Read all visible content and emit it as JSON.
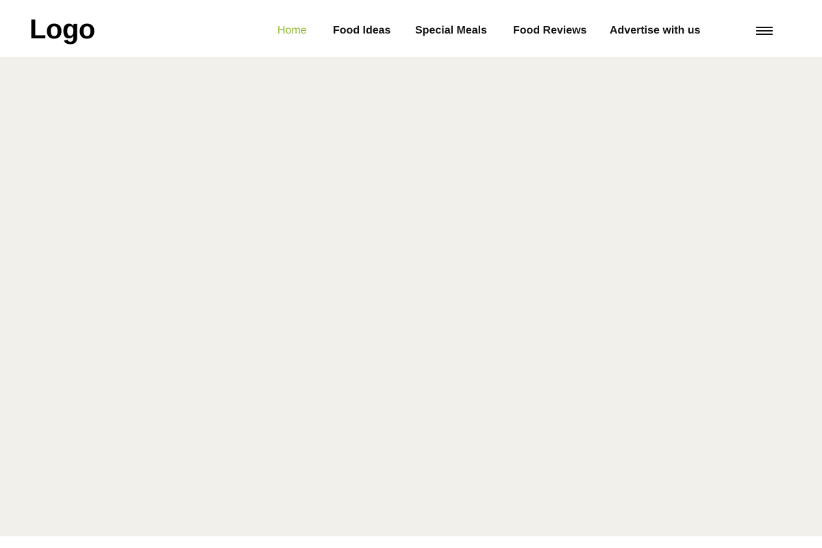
{
  "colors": {
    "accent": "#8bb72a",
    "hero_background": "#f2f0eb",
    "header_background": "#ffffff",
    "text": "#111111"
  },
  "header": {
    "logo_text": "Logo",
    "nav": [
      {
        "label": "Home",
        "active": true
      },
      {
        "label": "Food Ideas",
        "active": false
      },
      {
        "label": "Special Meals",
        "active": false
      },
      {
        "label": "Food Reviews",
        "active": false
      },
      {
        "label": "Advertise with us",
        "active": false
      }
    ],
    "menu_icon": "hamburger-menu-icon"
  }
}
